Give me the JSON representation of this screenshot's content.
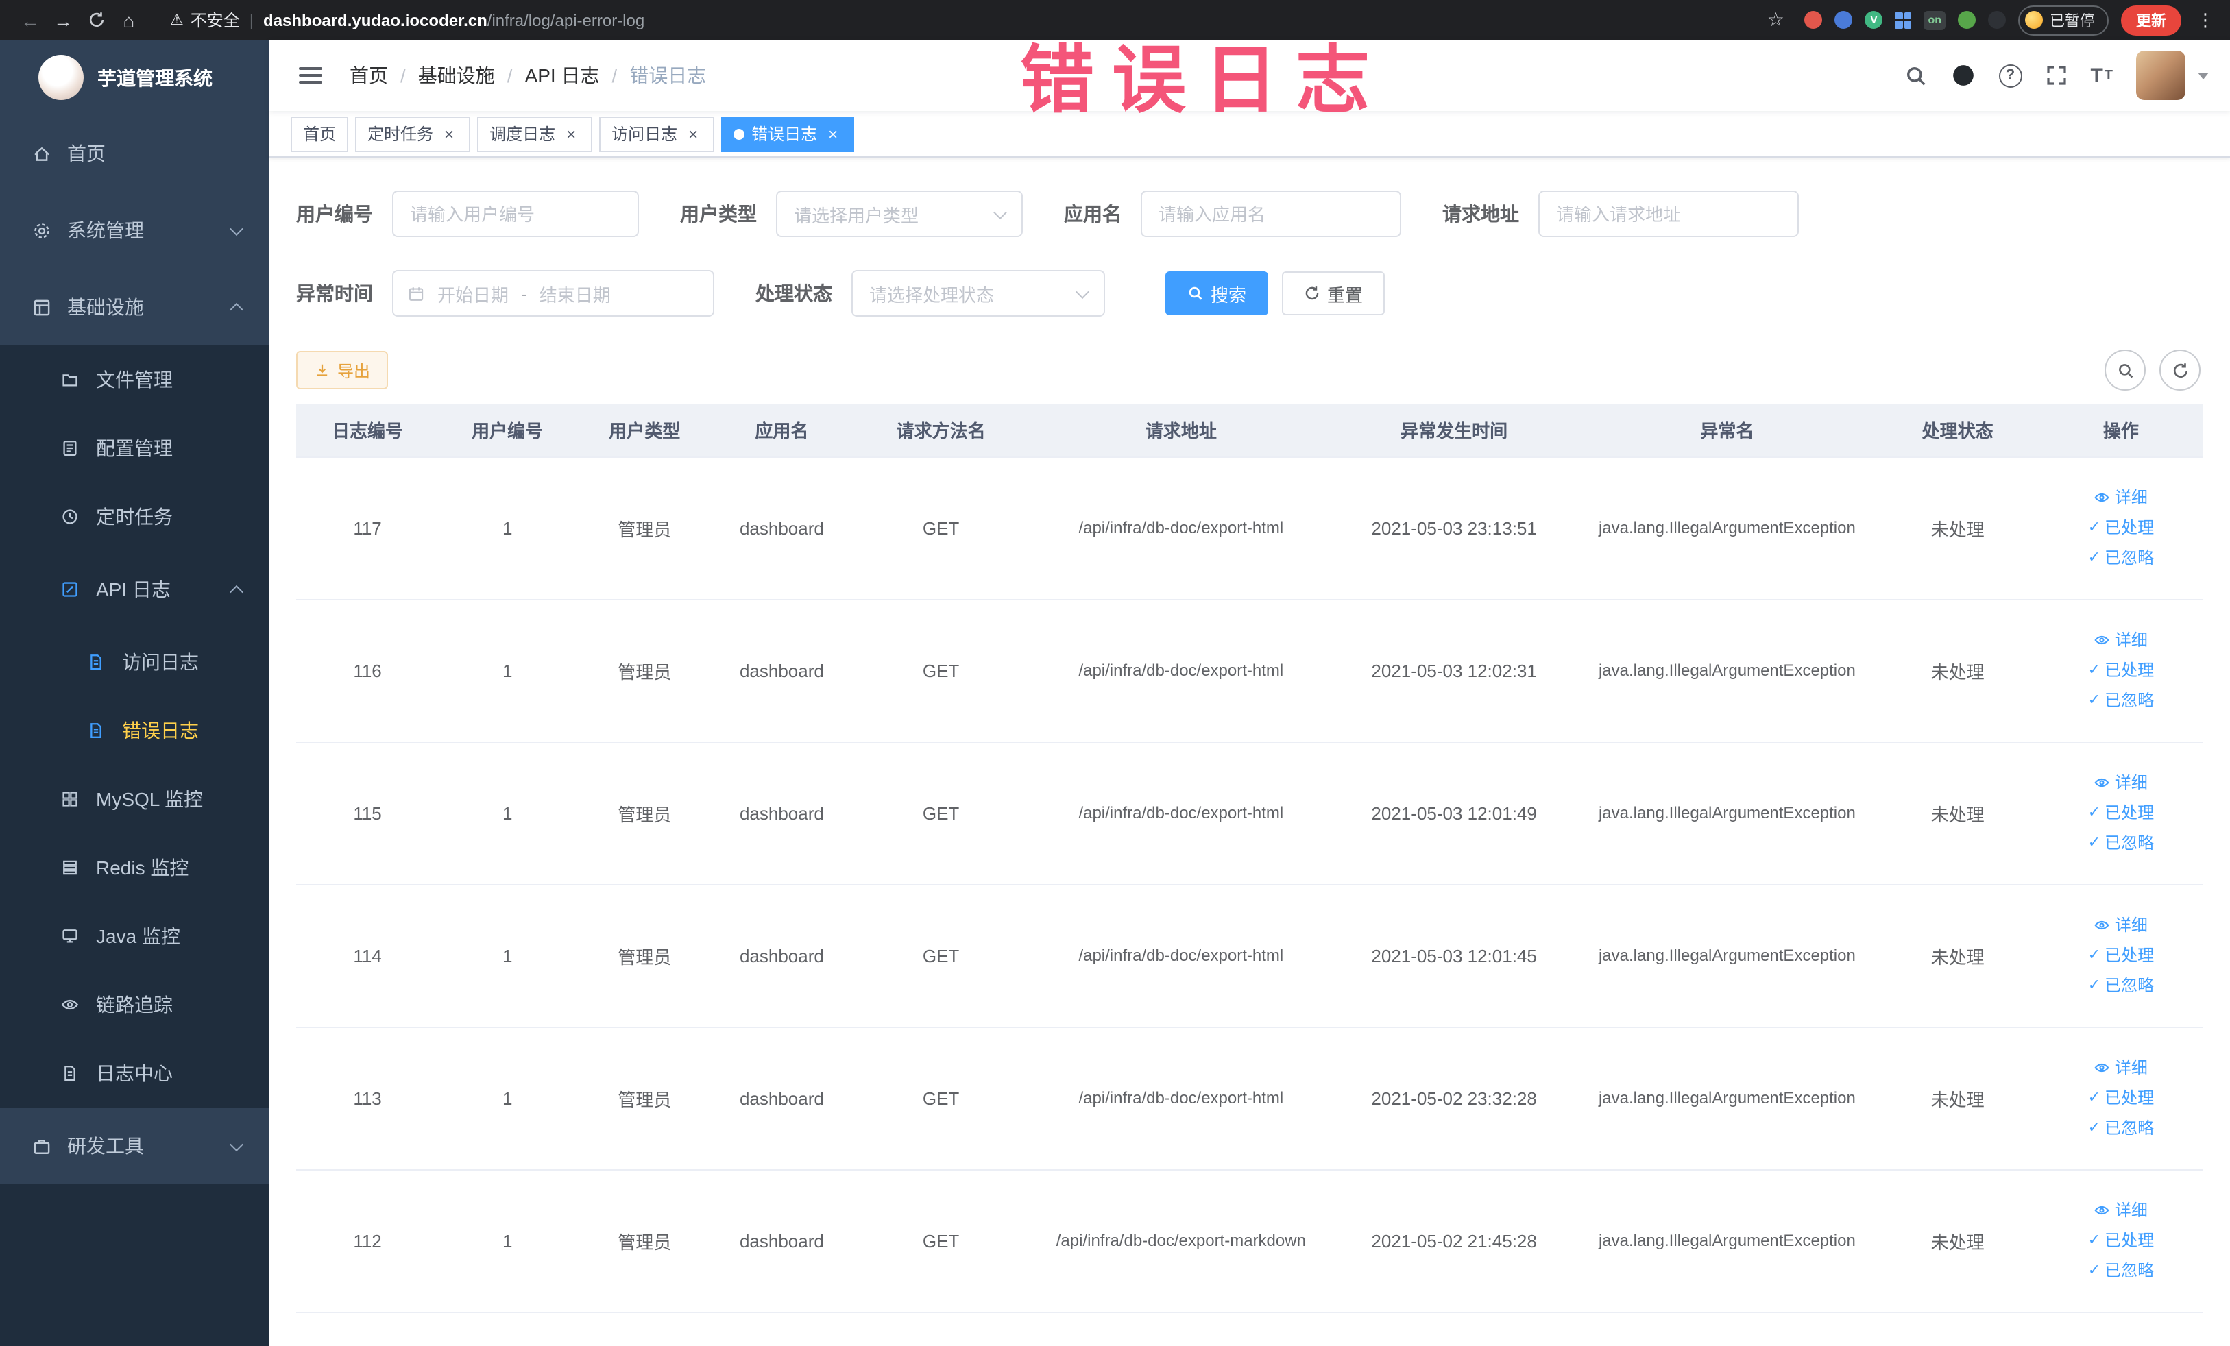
{
  "watermark": "错误日志",
  "icons": {
    "back": "←",
    "forward": "→",
    "home": "⌂",
    "star": "☆",
    "warning": "⚠",
    "pipe": "|",
    "close": "×",
    "check": "✓",
    "question": "?",
    "kebab": "⋮",
    "font": "T"
  },
  "browser": {
    "security_label": "不安全",
    "url_host": "dashboard.yudao.iocoder.cn",
    "url_path": "/infra/log/api-error-log",
    "vue_badge": "V",
    "ext_on_label": "on",
    "paused_label": "已暂停",
    "update_label": "更新"
  },
  "sidebar": {
    "logo_title": "芋道管理系统",
    "items": [
      {
        "label": "首页"
      },
      {
        "label": "系统管理"
      },
      {
        "label": "基础设施"
      },
      {
        "label": "文件管理"
      },
      {
        "label": "配置管理"
      },
      {
        "label": "定时任务"
      },
      {
        "label": "API 日志"
      },
      {
        "label": "访问日志"
      },
      {
        "label": "错误日志"
      },
      {
        "label": "MySQL 监控"
      },
      {
        "label": "Redis 监控"
      },
      {
        "label": "Java 监控"
      },
      {
        "label": "链路追踪"
      },
      {
        "label": "日志中心"
      },
      {
        "label": "研发工具"
      }
    ]
  },
  "navbar": {
    "separator": "/",
    "breadcrumb": [
      "首页",
      "基础设施",
      "API 日志",
      "错误日志"
    ]
  },
  "tags": [
    {
      "label": "首页"
    },
    {
      "label": "定时任务"
    },
    {
      "label": "调度日志"
    },
    {
      "label": "访问日志"
    },
    {
      "label": "错误日志"
    }
  ],
  "filters": {
    "user_id_label": "用户编号",
    "user_id_placeholder": "请输入用户编号",
    "user_type_label": "用户类型",
    "user_type_placeholder": "请选择用户类型",
    "app_name_label": "应用名",
    "app_name_placeholder": "请输入应用名",
    "request_url_label": "请求地址",
    "request_url_placeholder": "请输入请求地址",
    "time_label": "异常时间",
    "time_start_placeholder": "开始日期",
    "time_separator": "-",
    "time_end_placeholder": "结束日期",
    "status_label": "处理状态",
    "status_placeholder": "请选择处理状态",
    "search_label": "搜索",
    "reset_label": "重置"
  },
  "toolbar": {
    "export_label": "导出"
  },
  "table": {
    "headers": [
      "日志编号",
      "用户编号",
      "用户类型",
      "应用名",
      "请求方法名",
      "请求地址",
      "异常发生时间",
      "异常名",
      "处理状态",
      "操作"
    ],
    "action_labels": [
      "详细",
      "已处理",
      "已忽略"
    ],
    "rows": [
      {
        "id": "117",
        "user_id": "1",
        "user_type": "管理员",
        "app_name": "dashboard",
        "method": "GET",
        "url": "/api/infra/db-doc/export-html",
        "time": "2021-05-03 23:13:51",
        "exception": "java.lang.IllegalArgumentException",
        "status": "未处理"
      },
      {
        "id": "116",
        "user_id": "1",
        "user_type": "管理员",
        "app_name": "dashboard",
        "method": "GET",
        "url": "/api/infra/db-doc/export-html",
        "time": "2021-05-03 12:02:31",
        "exception": "java.lang.IllegalArgumentException",
        "status": "未处理"
      },
      {
        "id": "115",
        "user_id": "1",
        "user_type": "管理员",
        "app_name": "dashboard",
        "method": "GET",
        "url": "/api/infra/db-doc/export-html",
        "time": "2021-05-03 12:01:49",
        "exception": "java.lang.IllegalArgumentException",
        "status": "未处理"
      },
      {
        "id": "114",
        "user_id": "1",
        "user_type": "管理员",
        "app_name": "dashboard",
        "method": "GET",
        "url": "/api/infra/db-doc/export-html",
        "time": "2021-05-03 12:01:45",
        "exception": "java.lang.IllegalArgumentException",
        "status": "未处理"
      },
      {
        "id": "113",
        "user_id": "1",
        "user_type": "管理员",
        "app_name": "dashboard",
        "method": "GET",
        "url": "/api/infra/db-doc/export-html",
        "time": "2021-05-02 23:32:28",
        "exception": "java.lang.IllegalArgumentException",
        "status": "未处理"
      },
      {
        "id": "112",
        "user_id": "1",
        "user_type": "管理员",
        "app_name": "dashboard",
        "method": "GET",
        "url": "/api/infra/db-doc/export-markdown",
        "time": "2021-05-02 21:45:28",
        "exception": "java.lang.IllegalArgumentException",
        "status": "未处理"
      }
    ]
  }
}
